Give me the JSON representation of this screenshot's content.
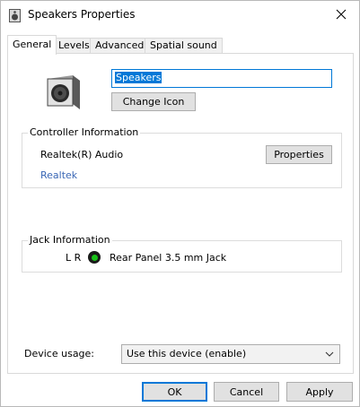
{
  "window": {
    "title": "Speakers Properties",
    "title_icon": "speaker-icon",
    "close_icon": "close-icon"
  },
  "tabs": [
    {
      "label": "General",
      "active": true
    },
    {
      "label": "Levels",
      "active": false
    },
    {
      "label": "Advanced",
      "active": false
    },
    {
      "label": "Spatial sound",
      "active": false
    }
  ],
  "general": {
    "device_icon": "speaker-icon",
    "name_value": "Speakers",
    "change_icon_label": "Change Icon",
    "controller": {
      "group_label": "Controller Information",
      "name": "Realtek(R) Audio",
      "vendor_link": "Realtek",
      "properties_label": "Properties"
    },
    "jack": {
      "group_label": "Jack Information",
      "channels": "L R",
      "description": "Rear Panel 3.5 mm Jack",
      "jack_color": "#19c219"
    },
    "device_usage": {
      "label": "Device usage:",
      "selected": "Use this device (enable)"
    }
  },
  "footer": {
    "ok_label": "OK",
    "cancel_label": "Cancel",
    "apply_label": "Apply"
  },
  "colors": {
    "accent": "#0078d7",
    "link": "#3a67b5"
  }
}
